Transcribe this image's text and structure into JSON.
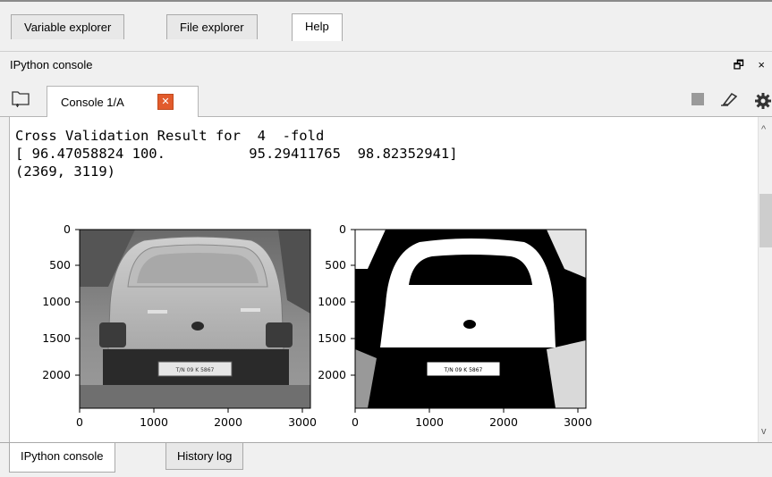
{
  "top_tabs": [
    {
      "label": "Variable explorer",
      "active": false
    },
    {
      "label": "File explorer",
      "active": false
    },
    {
      "label": "Help",
      "active": true
    }
  ],
  "pane": {
    "title": "IPython console",
    "controls": "🗗 ×"
  },
  "console_tabs": [
    {
      "label": "Console 1/A",
      "close_icon": "close-icon"
    }
  ],
  "output": {
    "lines": [
      "Cross Validation Result for  4  -fold",
      "[ 96.47058824 100.          95.29411765  98.82352941]",
      "(2369, 3119)"
    ]
  },
  "figures": [
    {
      "name": "grayscale-car-image",
      "x_ticks": [
        "0",
        "1000",
        "2000",
        "3000"
      ],
      "y_ticks": [
        "0",
        "500",
        "1000",
        "1500",
        "2000"
      ]
    },
    {
      "name": "binary-car-image",
      "x_ticks": [
        "0",
        "1000",
        "2000",
        "3000"
      ],
      "y_ticks": [
        "0",
        "500",
        "1000",
        "1500",
        "2000"
      ]
    }
  ],
  "bottom_tabs": [
    {
      "label": "IPython console",
      "active": true
    },
    {
      "label": "History log",
      "active": false
    }
  ],
  "colors": {
    "close_badge": "#e25b2c",
    "panel_bg": "#f0f0f0",
    "console_bg": "#ffffff"
  }
}
